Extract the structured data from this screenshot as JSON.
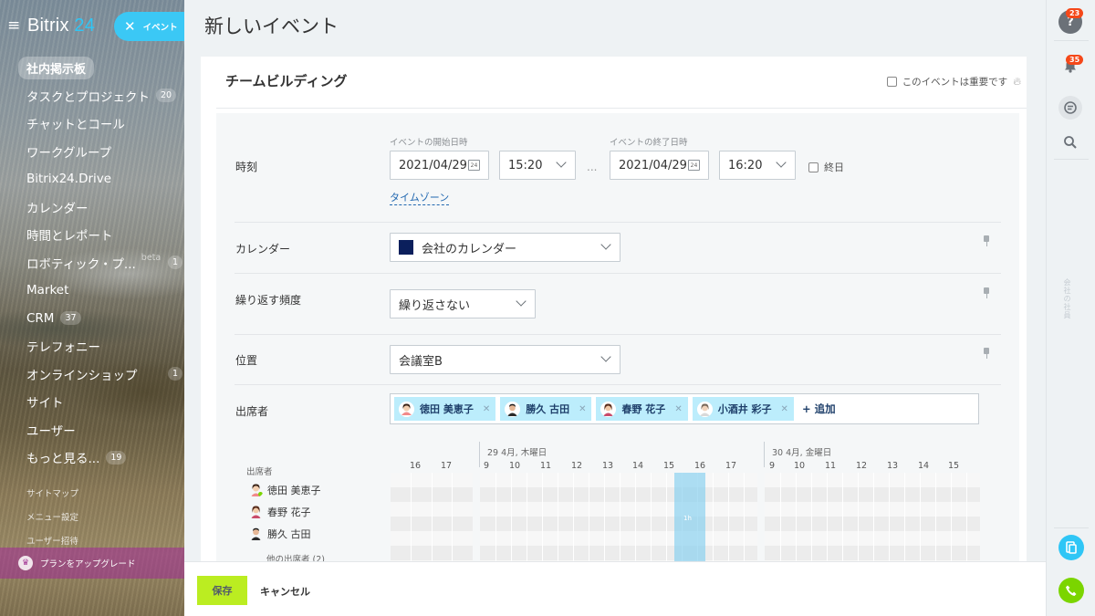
{
  "sidebar": {
    "logo_text": "Bitrix",
    "logo_num": "24",
    "event_button_label": "イベント",
    "items": [
      {
        "label": "社内掲示板",
        "active": true
      },
      {
        "label": "タスクとプロジェクト",
        "badge": "20"
      },
      {
        "label": "チャットとコール"
      },
      {
        "label": "ワークグループ"
      },
      {
        "label": "Bitrix24.Drive"
      },
      {
        "label": "カレンダー"
      },
      {
        "label": "時間とレポート"
      },
      {
        "label": "ロボティック・プ...",
        "beta": "beta",
        "badge": "1"
      },
      {
        "label": "Market"
      },
      {
        "label": "CRM",
        "badge": "37"
      },
      {
        "label": "テレフォニー"
      },
      {
        "label": "オンラインショップ",
        "badge": "1"
      },
      {
        "label": "サイト"
      },
      {
        "label": "ユーザー"
      },
      {
        "label": "もっと見る...",
        "badge": "19"
      }
    ],
    "sub_items": [
      "サイトマップ",
      "メニュー設定",
      "ユーザー招待"
    ],
    "upgrade_label": "プランをアップグレード"
  },
  "main": {
    "page_title": "新しいイベント",
    "event_title": "チームビルディング",
    "important_label": "このイベントは重要です",
    "time_label": "時刻",
    "start_label": "イベントの開始日時",
    "start_date": "2021/04/29",
    "start_time": "15:20",
    "end_label": "イベントの終了日時",
    "end_date": "2021/04/29",
    "end_time": "16:20",
    "dash": "...",
    "allday_label": "終日",
    "timezone_link": "タイムゾーン",
    "calendar_label": "カレンダー",
    "calendar_value": "会社のカレンダー",
    "calendar_color": "#0b1f5c",
    "repeat_label": "繰り返す頻度",
    "repeat_value": "繰り返さない",
    "location_label": "位置",
    "location_value": "会議室B",
    "attendees_label": "出席者",
    "attendee_chips": [
      "徳田 美恵子",
      "勝久 古田",
      "春野 花子",
      "小酒井 彩子"
    ],
    "add_label": "+ 追加",
    "planner": {
      "attendees_header": "出席者",
      "day1_header": "29 4月, 木曜日",
      "day2_header": "30 4月, 金曜日",
      "hours_prev": [
        "16",
        "17"
      ],
      "hours_day1": [
        "9",
        "10",
        "11",
        "12",
        "13",
        "14",
        "15",
        "16",
        "17"
      ],
      "hours_day2": [
        "9",
        "10",
        "11",
        "12",
        "13",
        "14",
        "15"
      ],
      "people": [
        "徳田 美恵子",
        "春野 花子",
        "勝久 古田"
      ],
      "other_attendees": "他の出席者 (2)",
      "highlight_label": "1h"
    },
    "save_label": "保存",
    "cancel_label": "キャンセル"
  },
  "rightbar": {
    "help_badge": "23",
    "bell_badge": "35",
    "vertical_text": "会社の社員",
    "accent": "#2fc6f6",
    "phone_color": "#7bd500"
  }
}
